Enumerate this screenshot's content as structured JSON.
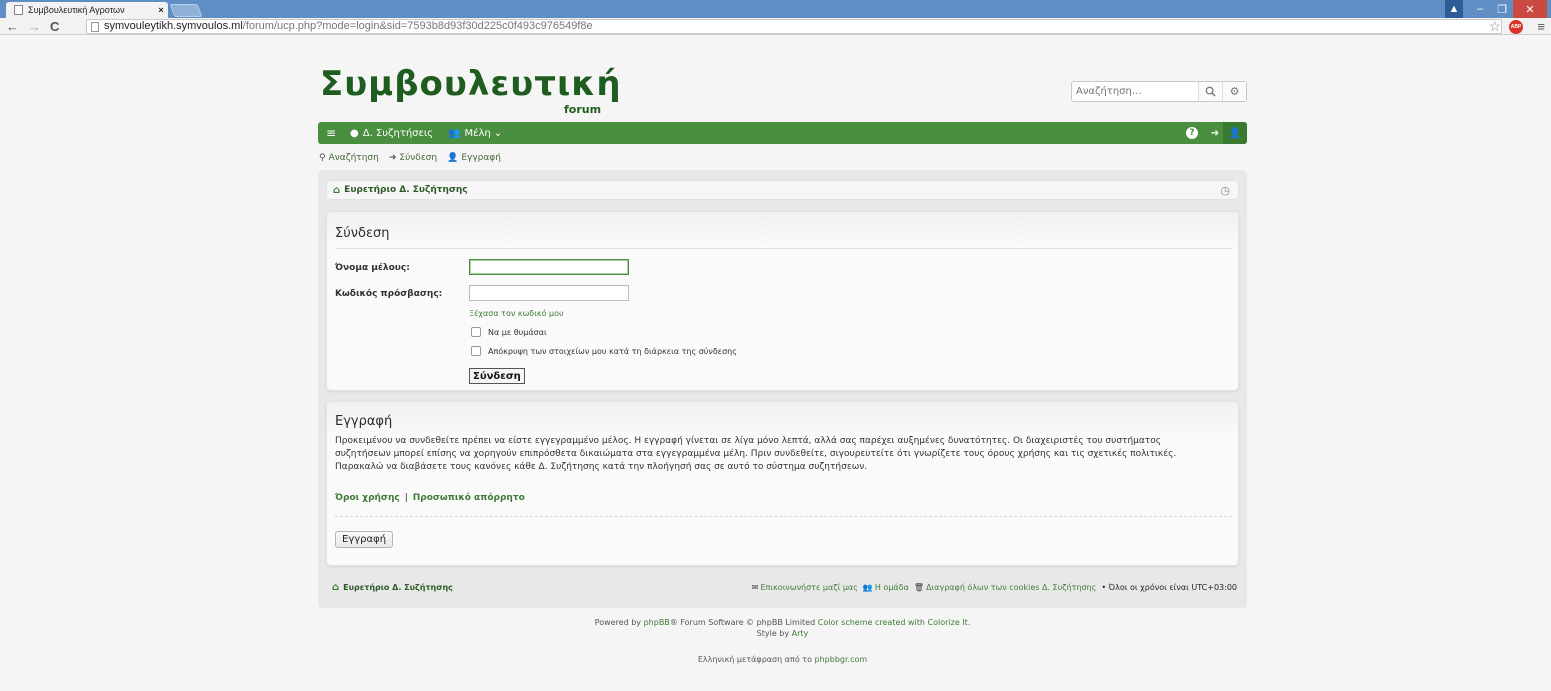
{
  "browser": {
    "tab_title": "Συμβουλευτική Αγροτων",
    "tab_close": "×",
    "url_host": "symvouleytikh.symvoulos.ml",
    "url_path": "/forum/ucp.php?mode=login&sid=7593b8d93f30d225c0f493c976549f8e",
    "abp_label": "ABP",
    "win_min": "–",
    "win_max": "❐",
    "win_close": "✕",
    "back": "←",
    "forward": "→",
    "reload": "C",
    "star": "☆",
    "menu": "≡"
  },
  "site": {
    "title": "Συμβουλευτική",
    "subtitle": "forum"
  },
  "search": {
    "placeholder": "Αναζήτηση…"
  },
  "navbar": {
    "menu_icon": "≡",
    "discussions": "Δ. Συζητήσεις",
    "members": "Μέλη ⌄",
    "help": "?"
  },
  "quicklinks": {
    "search": "Αναζήτηση",
    "login": "Σύνδεση",
    "register": "Εγγραφή"
  },
  "breadcrumb": {
    "label": "Ευρετήριο Δ. Συζήτησης"
  },
  "login": {
    "heading": "Σύνδεση",
    "username_label": "Όνομα μέλους:",
    "username_value": "",
    "password_label": "Κωδικός πρόσβασης:",
    "password_value": "",
    "forgot": "Ξέχασα τον κωδικό μου",
    "remember": "Να με θυμάσαι",
    "hide_online": "Απόκρυψη των στοιχείων μου κατά τη διάρκεια της σύνδεσης",
    "submit": "Σύνδεση"
  },
  "register": {
    "heading": "Εγγραφή",
    "line1": "Προκειμένου να συνδεθείτε πρέπει να είστε εγγεγραμμένο μέλος. Η εγγραφή γίνεται σε λίγα μόνο λεπτά, αλλά σας παρέχει αυξημένες δυνατότητες. Οι διαχειριστές του συστήματος",
    "line2": "συζητήσεων μπορεί επίσης να χορηγούν επιπρόσθετα δικαιώματα στα εγγεγραμμένα μέλη. Πριν συνδεθείτε, σιγουρευτείτε ότι γνωρίζετε τους όρους χρήσης και τις σχετικές πολιτικές.",
    "line3": "Παρακαλώ να διαβάσετε τους κανόνες κάθε Δ. Συζήτησης κατά την πλοήγησή σας σε αυτό το σύστημα συζητήσεων.",
    "terms": "Όροι χρήσης",
    "separator": "|",
    "privacy": "Προσωπικό απόρρητο",
    "button": "Εγγραφή"
  },
  "footer": {
    "home": "Ευρετήριο Δ. Συζήτησης",
    "contact": "Επικοινωνήστε μαζί μας",
    "team": "Η ομάδα",
    "delete_cookies": "Διαγραφή όλων των cookies Δ. Συζήτησης",
    "timezone": "• Όλοι οι χρόνοι είναι UTC+03:00"
  },
  "credits": {
    "powered_prefix": "Powered by",
    "phpbb": "phpBB",
    "powered_mid": "® Forum Software © phpBB Limited",
    "color_scheme": "Color scheme created with Colorize It.",
    "style_by": "Style by",
    "arty": "Arty",
    "translation_prefix": "Ελληνική μετάφραση από το",
    "translation_site": "phpbbgr.com"
  },
  "colors": {
    "brand_green": "#4a8f3f",
    "title_green": "#1f5c1f",
    "link_green": "#3f7c36"
  }
}
